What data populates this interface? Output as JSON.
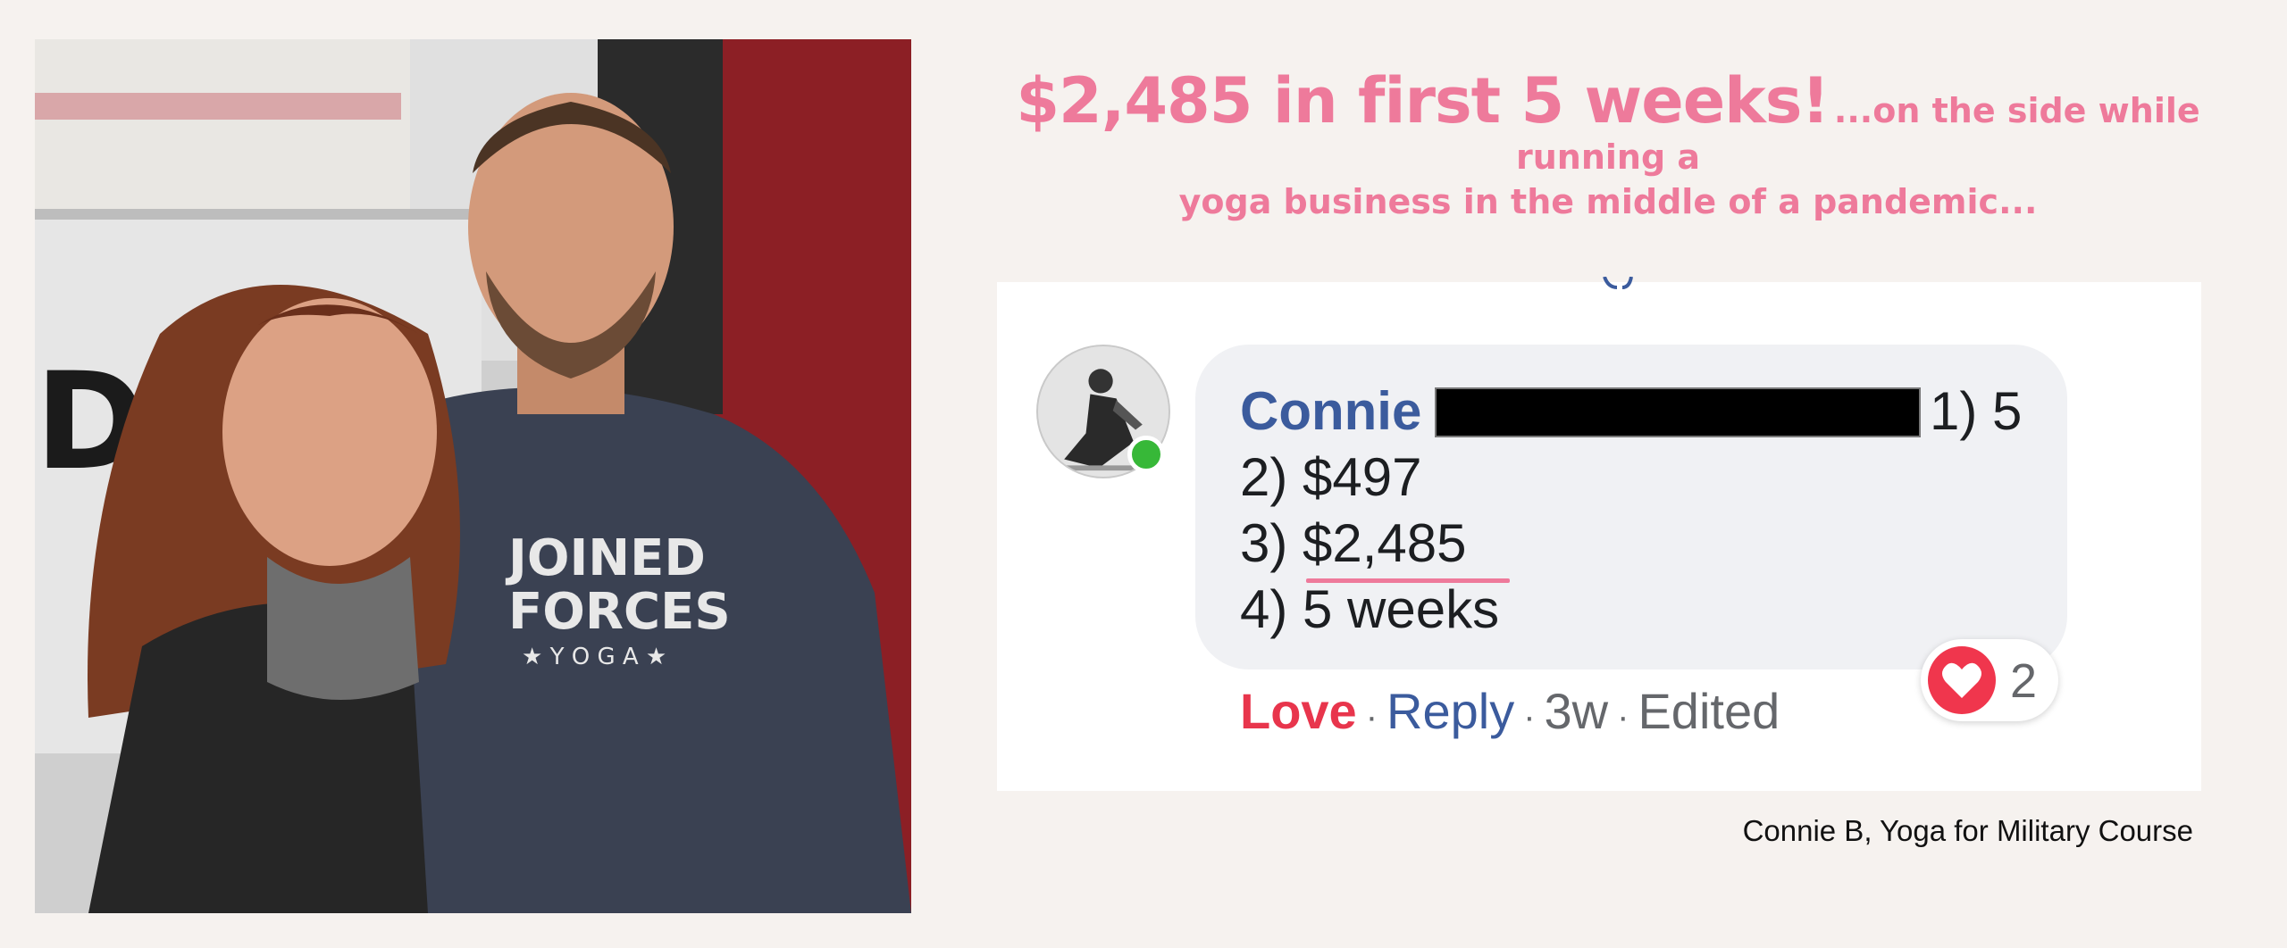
{
  "headline": {
    "big": "$2,485 in first 5 weeks!",
    "small": "...on the side while running a",
    "line2": "yoga business in the middle of a pandemic..."
  },
  "comment": {
    "name": "Connie",
    "line1_suffix": "1) 5",
    "line2": "2) $497",
    "line3": "3) $2,485",
    "line4": "4) 5 weeks",
    "actions": {
      "love": "Love",
      "reply": "Reply",
      "time": "3w",
      "edited": "Edited",
      "separator": "·"
    },
    "reaction_count": "2"
  },
  "photo": {
    "shirt_text_1": "JOINED",
    "shirt_text_2": "FORCES",
    "shirt_text_3": "★ Y O G A ★",
    "banner_text": "DIN"
  },
  "caption": "Connie B, Yoga for Military Course",
  "colors": {
    "accent_pink": "#ee7a9b",
    "facebook_blue": "#3b5b9d",
    "love_red": "#e8354c",
    "online_green": "#37b838"
  }
}
